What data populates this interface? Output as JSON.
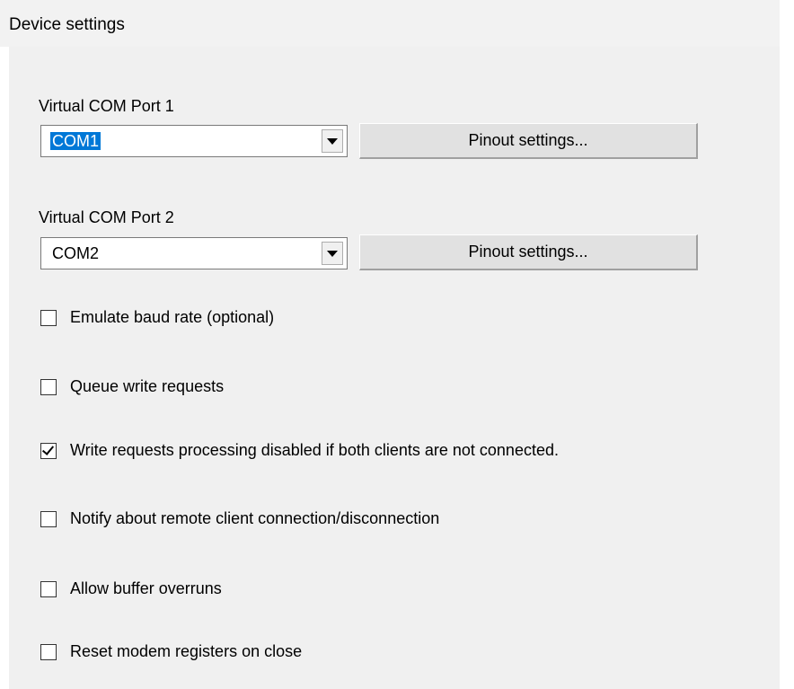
{
  "header": {
    "title": "Device settings"
  },
  "ports": [
    {
      "label": "Virtual COM Port 1",
      "value": "COM1",
      "selected": true,
      "button_label": "Pinout settings..."
    },
    {
      "label": "Virtual COM Port 2",
      "value": "COM2",
      "selected": false,
      "button_label": "Pinout settings..."
    }
  ],
  "options": [
    {
      "label": "Emulate baud rate (optional)",
      "checked": false
    },
    {
      "label": "Queue write requests",
      "checked": false
    },
    {
      "label": "Write requests processing disabled if both clients are not connected.",
      "checked": true
    },
    {
      "label": "Notify about remote client connection/disconnection",
      "checked": false
    },
    {
      "label": "Allow buffer overruns",
      "checked": false
    },
    {
      "label": "Reset modem registers on close",
      "checked": false
    }
  ],
  "colors": {
    "selection": "#0078d7",
    "panel_bg": "#f0f0f0"
  }
}
